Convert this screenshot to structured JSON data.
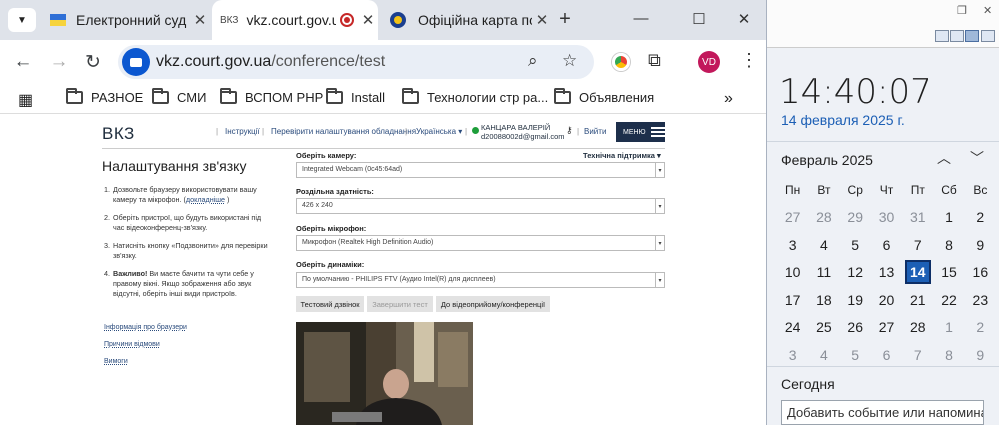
{
  "browser": {
    "tabs": [
      {
        "title": "Електронний суд",
        "favicon": "ukraine-flag"
      },
      {
        "title": "vkz.court.gov.ua/c",
        "favicon_text": "ВКЗ",
        "recording": true
      },
      {
        "title": "Офіційна карта по",
        "favicon": "court-seal"
      }
    ],
    "new_tab": "+",
    "window": {
      "minimize": "—",
      "maximize": "☐",
      "close": "✕"
    },
    "url_host": "vkz.court.gov.ua",
    "url_path": "/conference/test",
    "profile_initials": "VD",
    "bookmarks": [
      "РАЗНОЕ",
      "СМИ",
      "ВСПОМ PHP",
      "Install",
      "Технологии стр ра...",
      "Объявления"
    ],
    "bookmarks_overflow": "»"
  },
  "site": {
    "logo": "ВКЗ",
    "nav": {
      "instructions": "Інструкції",
      "check_settings": "Перевірити налаштування обладнання",
      "language": "Українська ▾",
      "user_name": "КАНЦАРА ВАЛЕРІЙ",
      "user_email": "d20088002d@gmail.com",
      "exit": "Вийти",
      "menu": "МЕНЮ"
    },
    "page_title": "Налаштування зв'язку",
    "steps": [
      {
        "n": "1.",
        "text": "Дозвольте браузеру використовувати вашу камеру та мікрофон. (",
        "link": "докладніше",
        "tail": " )"
      },
      {
        "n": "2.",
        "text": "Оберіть пристрої, що будуть використані під час відеоконференц-зв'язку."
      },
      {
        "n": "3.",
        "text": "Натисніть кнопку «Подзвонити» для перевірки зв'язку."
      },
      {
        "n": "4.",
        "bold": "Важливо!",
        "text": " Ви маєте бачити та чути себе у правому вікні. Якщо зображення або звук відсутні, оберіть інші види пристроїв."
      }
    ],
    "side_links": [
      "Інформація про браузери",
      "Причини відмови",
      "Вимоги"
    ],
    "support": "Технічна підтримка ▾",
    "form": {
      "camera_label": "Оберіть камеру:",
      "camera_value": "Integrated Webcam (0c45:64ad)",
      "resolution_label": "Роздільна здатність:",
      "resolution_value": "426 x 240",
      "mic_label": "Оберіть мікрофон:",
      "mic_value": "Микрофон (Realtek High Definition Audio)",
      "speaker_label": "Оберіть динаміки:",
      "speaker_value": "По умолчанию - PHILIPS FTV (Аудио Intel(R) для дисплеев)"
    },
    "buttons": {
      "test_call": "Тестовий дзвінок",
      "end_test": "Завершити тест",
      "to_conference": "До відеоприйому/конференції"
    }
  },
  "calendar": {
    "time": "14:40:07",
    "date": "14 февраля 2025 г.",
    "month": "Февраль 2025",
    "weekdays": [
      "Пн",
      "Вт",
      "Ср",
      "Чт",
      "Пт",
      "Сб",
      "Вс"
    ],
    "weeks": [
      [
        "27",
        "28",
        "29",
        "30",
        "31",
        "1",
        "2"
      ],
      [
        "3",
        "4",
        "5",
        "6",
        "7",
        "8",
        "9"
      ],
      [
        "10",
        "11",
        "12",
        "13",
        "14",
        "15",
        "16"
      ],
      [
        "17",
        "18",
        "19",
        "20",
        "21",
        "22",
        "23"
      ],
      [
        "24",
        "25",
        "26",
        "27",
        "28",
        "1",
        "2"
      ],
      [
        "3",
        "4",
        "5",
        "6",
        "7",
        "8",
        "9"
      ]
    ],
    "today_label": "Сегодня",
    "add_event": "Добавить событие или напоминание",
    "colors": {
      "accent": "#1c5fb5"
    }
  }
}
